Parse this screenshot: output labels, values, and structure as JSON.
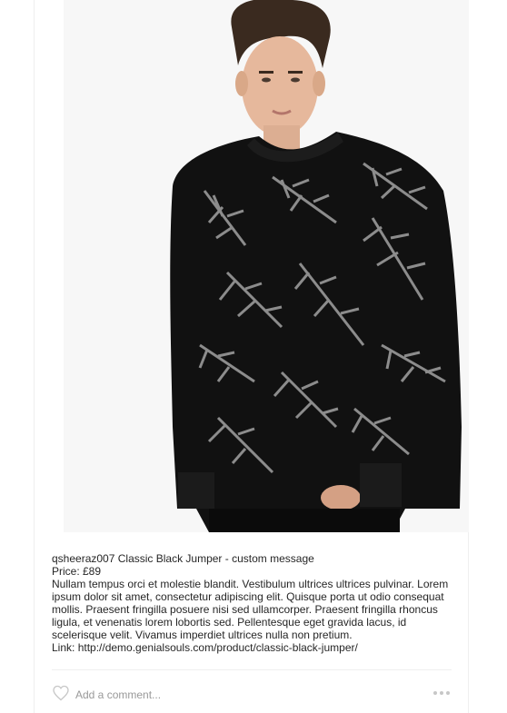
{
  "post": {
    "image_alt": "Man wearing black knit jumper with grey palm-leaf pattern",
    "username": "qsheeraz007",
    "title": "Classic Black Jumper - custom message",
    "price_line": "Price: £89",
    "description": "Nullam tempus orci et molestie blandit. Vestibulum ultrices ultrices pulvinar. Lorem ipsum dolor sit amet, consectetur adipiscing elit. Quisque porta ut odio consequat mollis. Praesent fringilla posuere nisi sed ullamcorper. Praesent fringilla rhoncus ligula, et venenatis lorem lobortis sed. Pellentesque eget gravida lacus, id scelerisque velit. Vivamus imperdiet ultrices nulla non pretium.",
    "link_prefix": "Link: ",
    "link_url": "http://demo.genialsouls.com/product/classic-black-jumper/"
  },
  "actions": {
    "like_icon": "heart-outline-icon",
    "comment_placeholder": "Add a comment...",
    "more_icon": "ellipsis-icon"
  },
  "colors": {
    "text": "#262626",
    "placeholder": "#999999",
    "border": "#efefef",
    "icon": "#c7c7c7"
  }
}
